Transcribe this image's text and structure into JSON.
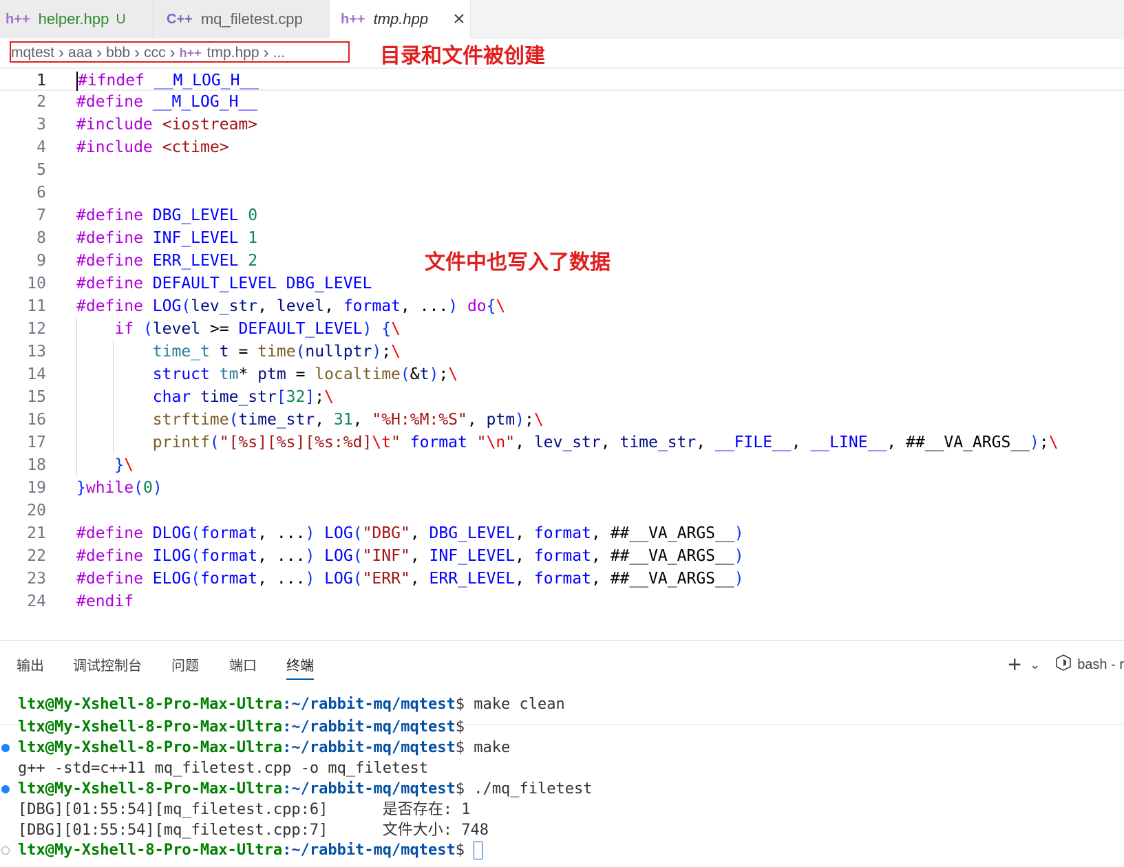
{
  "tabs": [
    {
      "icon": "h++",
      "label": "helper.hpp",
      "badge": "U"
    },
    {
      "icon": "C++",
      "label": "mq_filetest.cpp"
    },
    {
      "icon": "h++",
      "label": "tmp.hpp",
      "close": "×"
    }
  ],
  "breadcrumb": {
    "items": [
      "mqtest",
      "aaa",
      "bbb",
      "ccc"
    ],
    "file_icon": "h++",
    "file": "tmp.hpp",
    "more": "..."
  },
  "annotations": {
    "breadcrumb_note": "目录和文件被创建",
    "editor_note": "文件中也写入了数据"
  },
  "code_lines": [
    {
      "n": "1",
      "text": "#ifndef __M_LOG_H__"
    },
    {
      "n": "2",
      "text": "#define __M_LOG_H__"
    },
    {
      "n": "3",
      "text": "#include <iostream>"
    },
    {
      "n": "4",
      "text": "#include <ctime>"
    },
    {
      "n": "5",
      "text": ""
    },
    {
      "n": "6",
      "text": ""
    },
    {
      "n": "7",
      "text": "#define DBG_LEVEL 0"
    },
    {
      "n": "8",
      "text": "#define INF_LEVEL 1"
    },
    {
      "n": "9",
      "text": "#define ERR_LEVEL 2"
    },
    {
      "n": "10",
      "text": "#define DEFAULT_LEVEL DBG_LEVEL"
    },
    {
      "n": "11",
      "text": "#define LOG(lev_str, level, format, ...) do{\\"
    },
    {
      "n": "12",
      "text": "    if (level >= DEFAULT_LEVEL) {\\"
    },
    {
      "n": "13",
      "text": "        time_t t = time(nullptr);\\"
    },
    {
      "n": "14",
      "text": "        struct tm* ptm = localtime(&t);\\"
    },
    {
      "n": "15",
      "text": "        char time_str[32];\\"
    },
    {
      "n": "16",
      "text": "        strftime(time_str, 31, \"%H:%M:%S\", ptm);\\"
    },
    {
      "n": "17",
      "text": "        printf(\"[%s][%s][%s:%d]\\t\" format \"\\n\", lev_str, time_str, __FILE__, __LINE__, ##__VA_ARGS__);\\"
    },
    {
      "n": "18",
      "text": "    }\\"
    },
    {
      "n": "19",
      "text": "}while(0)"
    },
    {
      "n": "20",
      "text": ""
    },
    {
      "n": "21",
      "text": "#define DLOG(format, ...) LOG(\"DBG\", DBG_LEVEL, format, ##__VA_ARGS__)"
    },
    {
      "n": "22",
      "text": "#define ILOG(format, ...) LOG(\"INF\", INF_LEVEL, format, ##__VA_ARGS__)"
    },
    {
      "n": "23",
      "text": "#define ELOG(format, ...) LOG(\"ERR\", ERR_LEVEL, format, ##__VA_ARGS__)"
    },
    {
      "n": "24",
      "text": "#endif"
    }
  ],
  "panel": {
    "tabs": [
      "输出",
      "调试控制台",
      "问题",
      "端口",
      "终端"
    ],
    "active_tab": "终端",
    "add_icon": "+",
    "dropdown_icon": "chevron-down",
    "terminal_name": "bash - r"
  },
  "terminal": {
    "user_host": "ltx@My-Xshell-8-Pro-Max-Ultra",
    "path": ":~/rabbit-mq/mqtest",
    "lines": [
      {
        "kind": "prompt",
        "cmd": "make clean",
        "dot": ""
      },
      {
        "kind": "prompt",
        "cmd": "",
        "dot": ""
      },
      {
        "kind": "prompt",
        "cmd": "make",
        "dot": "blue"
      },
      {
        "kind": "output",
        "text": "g++ -std=c++11 mq_filetest.cpp -o mq_filetest"
      },
      {
        "kind": "prompt",
        "cmd": "./mq_filetest",
        "dot": "blue"
      },
      {
        "kind": "output",
        "text": "[DBG][01:55:54][mq_filetest.cpp:6]      是否存在: 1"
      },
      {
        "kind": "output",
        "text": "[DBG][01:55:54][mq_filetest.cpp:7]      文件大小: 748"
      },
      {
        "kind": "prompt",
        "cmd": "",
        "dot": "gray",
        "cursor": true
      }
    ]
  },
  "colors": {
    "annotation_red": "#e01e1e",
    "preprocessor": "#af00db",
    "macro": "#0000ff",
    "string": "#a31515",
    "prompt_user": "#008000",
    "prompt_path": "#0451a5"
  }
}
